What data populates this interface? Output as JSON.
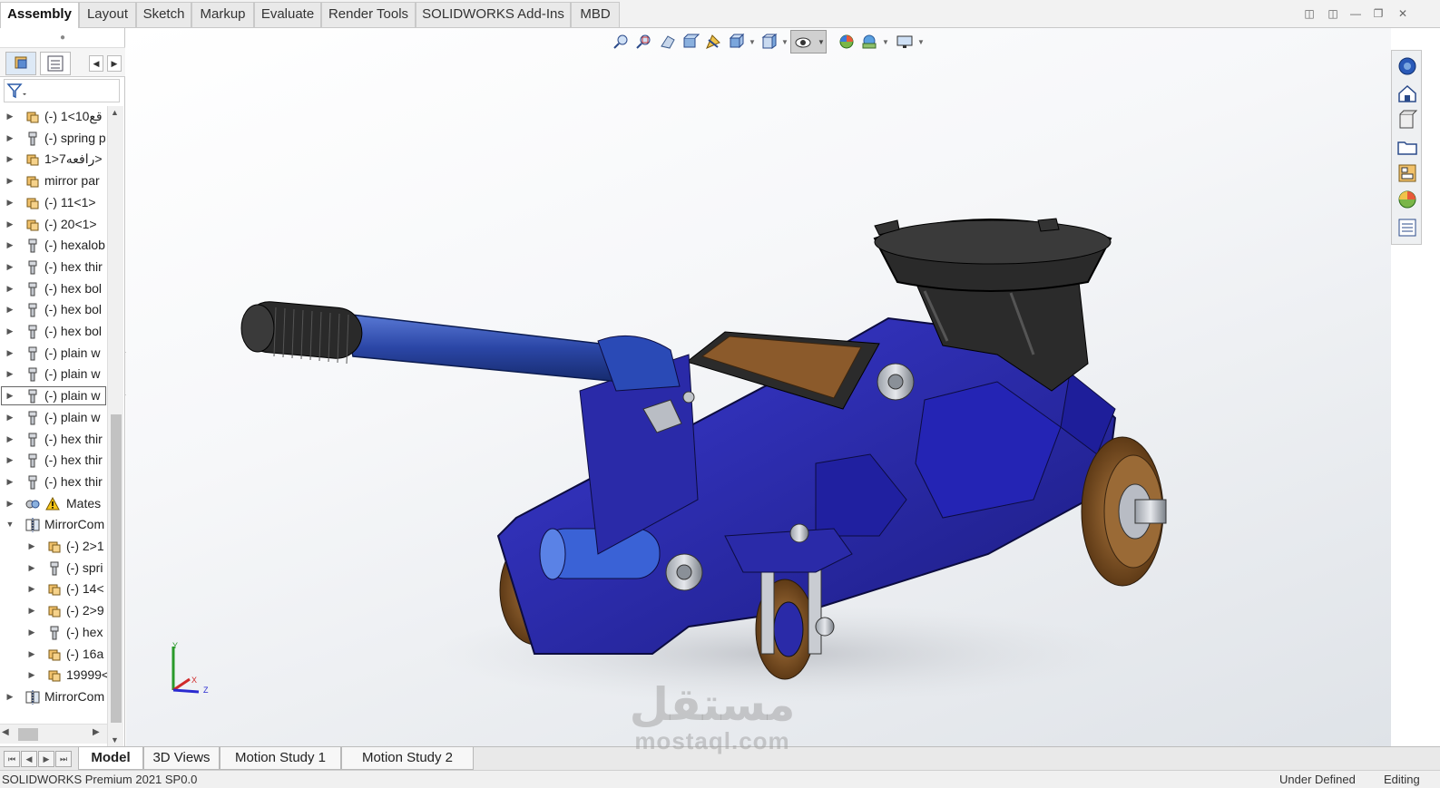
{
  "ribbon": {
    "tabs": [
      {
        "label": "Assembly",
        "active": true
      },
      {
        "label": "Layout"
      },
      {
        "label": "Sketch"
      },
      {
        "label": "Markup"
      },
      {
        "label": "Evaluate"
      },
      {
        "label": "Render Tools"
      },
      {
        "label": "SOLIDWORKS Add-Ins"
      },
      {
        "label": "MBD"
      }
    ]
  },
  "tree": {
    "items": [
      {
        "label": "(-) 1<10قع",
        "icon": "subassembly-icon",
        "indent": 0
      },
      {
        "label": "(-) spring p",
        "icon": "part-icon",
        "indent": 0
      },
      {
        "label": "رافعه7<1>",
        "icon": "subassembly-icon",
        "indent": 0
      },
      {
        "label": "mirror par",
        "icon": "subassembly-icon",
        "indent": 0
      },
      {
        "label": "(-) 11<1>",
        "icon": "subassembly-icon",
        "indent": 0
      },
      {
        "label": "(-) 20<1>",
        "icon": "subassembly-icon",
        "indent": 0
      },
      {
        "label": "(-) hexalob",
        "icon": "part-icon",
        "indent": 0
      },
      {
        "label": "(-) hex thir",
        "icon": "part-icon",
        "indent": 0
      },
      {
        "label": "(-) hex bol",
        "icon": "part-icon",
        "indent": 0
      },
      {
        "label": "(-) hex bol",
        "icon": "part-icon",
        "indent": 0
      },
      {
        "label": "(-) hex bol",
        "icon": "part-icon",
        "indent": 0
      },
      {
        "label": "(-) plain w",
        "icon": "part-icon",
        "indent": 0
      },
      {
        "label": "(-) plain w",
        "icon": "part-icon",
        "indent": 0
      },
      {
        "label": "(-) plain w",
        "icon": "part-icon",
        "indent": 0,
        "selected": true
      },
      {
        "label": "(-) plain w",
        "icon": "part-icon",
        "indent": 0
      },
      {
        "label": "(-) hex thir",
        "icon": "part-icon",
        "indent": 0
      },
      {
        "label": "(-) hex thir",
        "icon": "part-icon",
        "indent": 0
      },
      {
        "label": "(-) hex thir",
        "icon": "part-icon",
        "indent": 0
      },
      {
        "label": "Mates",
        "icon": "mates-icon",
        "indent": 0,
        "warning": true
      },
      {
        "label": "MirrorCom",
        "icon": "mirror-component-icon",
        "indent": 0,
        "expanded": true
      },
      {
        "label": "(-) 2>1",
        "icon": "subassembly-icon",
        "indent": 1
      },
      {
        "label": "(-) spri",
        "icon": "part-icon",
        "indent": 1
      },
      {
        "label": "(-) 14<",
        "icon": "subassembly-icon",
        "indent": 1
      },
      {
        "label": "(-) 2>9",
        "icon": "subassembly-icon",
        "indent": 1
      },
      {
        "label": "(-) hex",
        "icon": "part-icon",
        "indent": 1
      },
      {
        "label": "(-) 16a",
        "icon": "subassembly-icon",
        "indent": 1
      },
      {
        "label": "19999<",
        "icon": "subassembly-icon",
        "indent": 1
      },
      {
        "label": "MirrorCom",
        "icon": "mirror-component-icon",
        "indent": 0
      }
    ]
  },
  "viewport": {
    "triad": {
      "x": "X",
      "y": "Y",
      "z": "Z"
    }
  },
  "bottom_tabs": [
    {
      "label": "Model",
      "active": true
    },
    {
      "label": "3D Views"
    },
    {
      "label": "Motion Study 1"
    },
    {
      "label": "Motion Study 2"
    }
  ],
  "status": {
    "product": "SOLIDWORKS Premium 2021 SP0.0",
    "state": "Under Defined",
    "mode": "Editing"
  },
  "watermark": {
    "arabic": "مستقل",
    "latin": "mostaql.com"
  },
  "colors": {
    "jack_body": "#2a2aa8",
    "handle": "#2f4ca8",
    "wheel": "#8a5a2a",
    "saddle": "#2b2b2b",
    "plate": "#8b5a2b"
  }
}
